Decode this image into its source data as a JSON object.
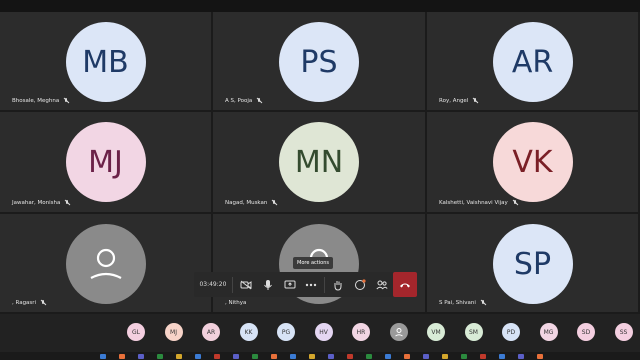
{
  "tiles": [
    {
      "initials": "MB",
      "name": "Bhosale, Meghna",
      "bg": "#dce6f7",
      "fg": "#1f3a66"
    },
    {
      "initials": "PS",
      "name": "A S, Pooja",
      "bg": "#dce6f7",
      "fg": "#1f3a66"
    },
    {
      "initials": "AR",
      "name": "Roy, Angel",
      "bg": "#dce6f7",
      "fg": "#1f3a66"
    },
    {
      "initials": "MJ",
      "name": "Jawahar, Monisha",
      "bg": "#f2d6e4",
      "fg": "#6b2148"
    },
    {
      "initials": "MN",
      "name": "Nagad, Muskan",
      "bg": "#dfe6d5",
      "fg": "#344b2f"
    },
    {
      "initials": "VK",
      "name": "Kalshetti, Vaishnavi Vijay",
      "bg": "#f7d9d9",
      "fg": "#7a1f26"
    },
    {
      "initials": "",
      "name": ", Ragasri",
      "bg": "#8a8a8a",
      "fg": "#fff",
      "avatar_icon": "person-icon"
    },
    {
      "initials": "",
      "name": ", Nithya",
      "bg": "#8a8a8a",
      "fg": "#fff",
      "avatar_icon": "person-icon"
    },
    {
      "initials": "SP",
      "name": "S Pai, Shivani",
      "bg": "#dce6f7",
      "fg": "#1f3a66"
    }
  ],
  "toolbar": {
    "timer": "03:49:20",
    "buttons": [
      {
        "id": "camera-off",
        "icon": "camera-off-icon"
      },
      {
        "id": "mic",
        "icon": "microphone-icon"
      },
      {
        "id": "share",
        "icon": "share-screen-icon"
      },
      {
        "id": "more",
        "icon": "more-actions-icon"
      },
      {
        "id": "raise-hand",
        "icon": "raise-hand-icon"
      },
      {
        "id": "chat",
        "icon": "chat-icon"
      },
      {
        "id": "participants",
        "icon": "participants-icon"
      }
    ],
    "tooltip": "More actions",
    "hangup_color": "#a4262c"
  },
  "participants_strip": [
    {
      "initials": "GL",
      "bg": "#f4cfe0"
    },
    {
      "initials": "MJ",
      "bg": "#f7d3c8"
    },
    {
      "initials": "AR",
      "bg": "#f2d0dc"
    },
    {
      "initials": "KK",
      "bg": "#d7e3f6"
    },
    {
      "initials": "PG",
      "bg": "#d7e3f6"
    },
    {
      "initials": "HV",
      "bg": "#e4d6f2"
    },
    {
      "initials": "HR",
      "bg": "#f2d6e4"
    },
    {
      "initials": "",
      "bg": "#9a9a9a",
      "icon": "person-icon"
    },
    {
      "initials": "VM",
      "bg": "#d8ebd6"
    },
    {
      "initials": "SM",
      "bg": "#d8ebd6"
    },
    {
      "initials": "PD",
      "bg": "#d7e3f6"
    },
    {
      "initials": "MG",
      "bg": "#f2d6e4"
    },
    {
      "initials": "SD",
      "bg": "#f4cfe0"
    },
    {
      "initials": "SS",
      "bg": "#f4cfe0"
    }
  ]
}
